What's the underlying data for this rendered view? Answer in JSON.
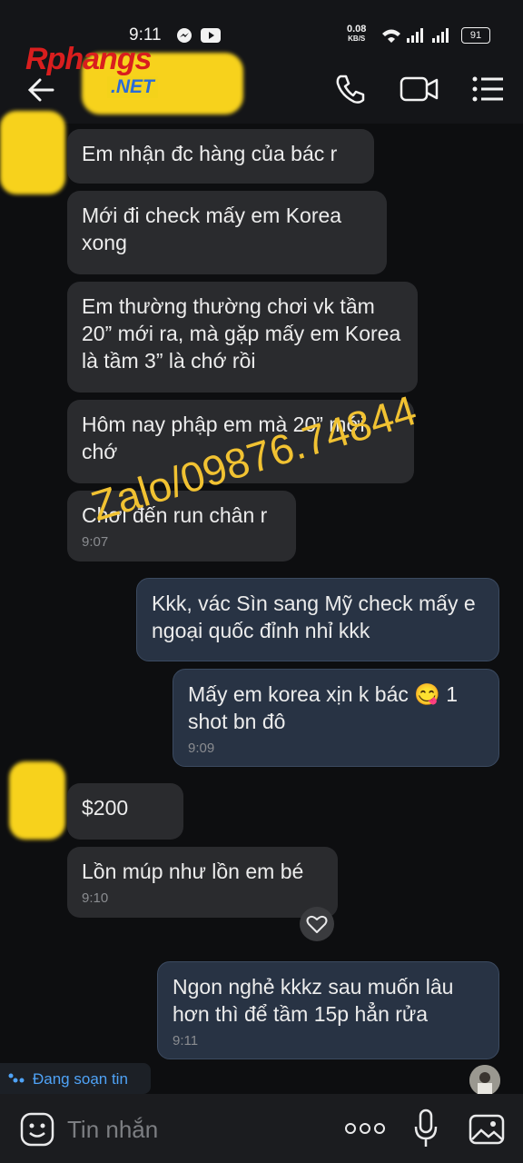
{
  "status_bar": {
    "time": "9:11",
    "net_speed": "0.08",
    "net_unit": "KB/S",
    "battery": "91"
  },
  "watermark_logo": {
    "text_a": "R",
    "text_b": "phangs",
    "text_net": ".NET"
  },
  "header": {
    "back": "back",
    "icons": [
      "phone-icon",
      "video-icon",
      "menu-icon"
    ]
  },
  "messages": [
    {
      "dir": "in",
      "text": "Em nhận đc hàng của bác r",
      "time": ""
    },
    {
      "dir": "in",
      "text": "Mới đi check mấy em Korea xong",
      "time": ""
    },
    {
      "dir": "in",
      "text": "Em thường thường chơi vk tầm 20” mới ra, mà gặp mấy em Korea là tầm 3” là chớ rồi",
      "time": ""
    },
    {
      "dir": "in",
      "text": "Hôm nay phập em mà 20” mới chớ",
      "time": ""
    },
    {
      "dir": "in",
      "text": "Chơi đến run chân r",
      "time": "9:07"
    },
    {
      "dir": "out",
      "text": "Kkk, vác Sìn sang Mỹ check mấy e ngoại quốc đỉnh nhỉ kkk",
      "time": ""
    },
    {
      "dir": "out",
      "text": "Mấy em korea xịn k bác",
      "text2": "1 shot bn đô",
      "emoji": "😋",
      "time": "9:09"
    },
    {
      "dir": "in",
      "text": "$200",
      "time": ""
    },
    {
      "dir": "in",
      "text": "Lồn múp như lồn em bé",
      "time": "9:10"
    },
    {
      "dir": "out",
      "text": "Ngon nghẻ kkkz sau muốn lâu hơn thì để tầm 15p hẳn rửa",
      "time": "9:11"
    }
  ],
  "overlay_text": "Zalo/09876.74844",
  "typing_indicator": "Đang soạn tin",
  "input": {
    "placeholder": "Tin nhắn"
  },
  "colors": {
    "incoming": "#2a2b2e",
    "outgoing": "#283344",
    "accent": "#4fa3f7"
  }
}
